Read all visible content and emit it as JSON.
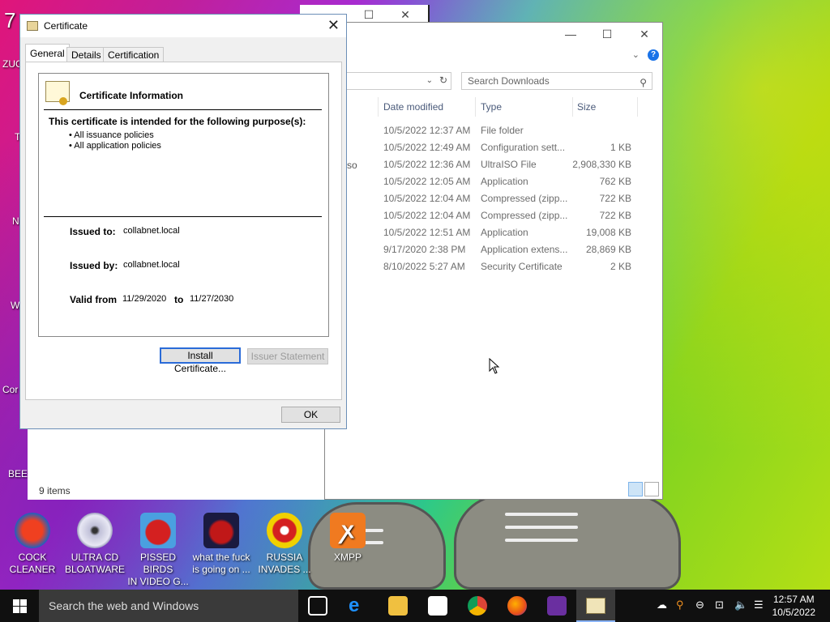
{
  "desktop": {
    "icons": [
      {
        "name": "cock-cleaner-icon",
        "label_line1": "COCK",
        "label_line2": "CLEANER"
      },
      {
        "name": "ultra-cd-icon",
        "label_line1": "ULTRA CD",
        "label_line2": "BLOATWARE"
      },
      {
        "name": "pissed-birds-icon",
        "label_line1": "PISSED BIRDS",
        "label_line2": "IN VIDEO G..."
      },
      {
        "name": "angry-birds-space-icon",
        "label_line1": "what the fuck",
        "label_line2": "is going on ..."
      },
      {
        "name": "russia-invades-icon",
        "label_line1": "RUSSIA",
        "label_line2": "INVADES ..."
      },
      {
        "name": "xampp-icon",
        "label_line1": "XMPP",
        "label_line2": ""
      }
    ],
    "side_fragments": [
      "7",
      "ZUC",
      "T",
      "N",
      "W",
      "Cor",
      "BEEF"
    ]
  },
  "explorer": {
    "search_placeholder": "Search Downloads",
    "columns": {
      "date": "Date modified",
      "type": "Type",
      "size": "Size"
    },
    "rows": [
      {
        "date": "10/5/2022 12:37 AM",
        "type": "File folder",
        "size": ""
      },
      {
        "date": "10/5/2022 12:49 AM",
        "type": "Configuration sett...",
        "size": "1 KB"
      },
      {
        "date": "10/5/2022 12:36 AM",
        "type": "UltraISO File",
        "size": "2,908,330 KB"
      },
      {
        "date": "10/5/2022 12:05 AM",
        "type": "Application",
        "size": "762 KB"
      },
      {
        "date": "10/5/2022 12:04 AM",
        "type": "Compressed (zipp...",
        "size": "722 KB"
      },
      {
        "date": "10/5/2022 12:04 AM",
        "type": "Compressed (zipp...",
        "size": "722 KB"
      },
      {
        "date": "10/5/2022 12:51 AM",
        "type": "Application",
        "size": "19,008 KB"
      },
      {
        "date": "9/17/2020 2:38 PM",
        "type": "Application extens...",
        "size": "28,869 KB"
      },
      {
        "date": "8/10/2022 5:27 AM",
        "type": "Security Certificate",
        "size": "2 KB"
      }
    ],
    "name_fragment": "so",
    "status": "9 items"
  },
  "certificate": {
    "title": "Certificate",
    "tabs": [
      "General",
      "Details",
      "Certification Path"
    ],
    "heading": "Certificate Information",
    "purpose_heading": "This certificate is intended for the following purpose(s):",
    "purposes": [
      "• All issuance policies",
      "• All application policies"
    ],
    "issued_to_label": "Issued to:",
    "issued_to": "collabnet.local",
    "issued_by_label": "Issued by:",
    "issued_by": "collabnet.local",
    "valid_from_label": "Valid from",
    "valid_from": "11/29/2020",
    "to_label": "to",
    "valid_to": "11/27/2030",
    "install_button": "Install Certificate...",
    "issuer_button": "Issuer Statement",
    "ok_button": "OK"
  },
  "taskbar": {
    "search_placeholder": "Search the web and Windows",
    "time": "12:57 AM",
    "date": "10/5/2022"
  }
}
